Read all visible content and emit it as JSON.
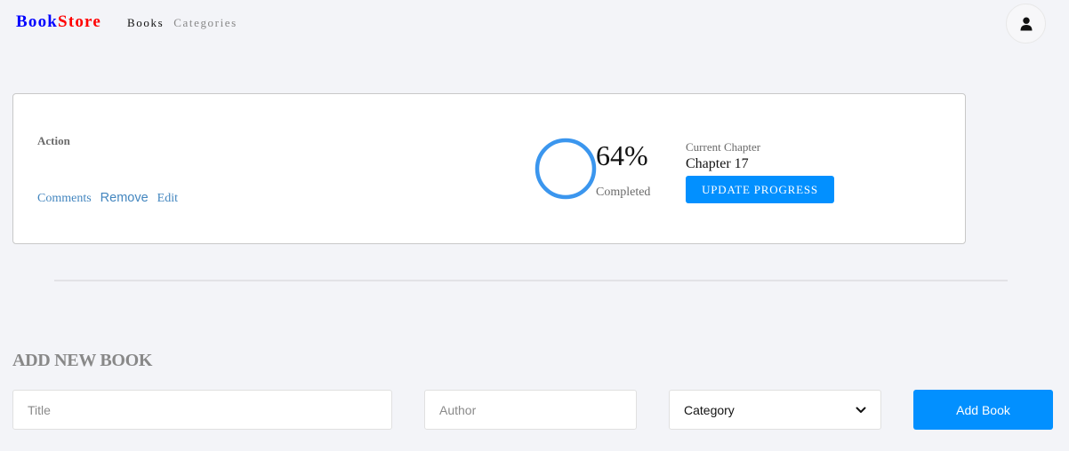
{
  "header": {
    "logo_part1": "Book",
    "logo_part2": "Store",
    "logo_colors": {
      "part1": "#0000ff",
      "part2": "#ff0000"
    },
    "nav": [
      {
        "label": "Books",
        "active": true
      },
      {
        "label": "Categories",
        "active": false
      }
    ],
    "user_icon": "user-icon"
  },
  "book_card": {
    "action_label": "Action",
    "links": {
      "comments": "Comments",
      "remove": "Remove",
      "edit": "Edit"
    },
    "progress": {
      "percent_text": "64%",
      "percent_value": 64,
      "completed_label": "Completed",
      "ring_color": "#3b96ee"
    },
    "chapter": {
      "label": "Current Chapter",
      "value": "Chapter 17"
    },
    "update_button": "UPDATE PROGRESS"
  },
  "add_form": {
    "title": "ADD NEW BOOK",
    "title_placeholder": "Title",
    "author_placeholder": "Author",
    "category_selected": "Category",
    "submit_label": "Add Book",
    "accent_color": "#0290ff"
  }
}
